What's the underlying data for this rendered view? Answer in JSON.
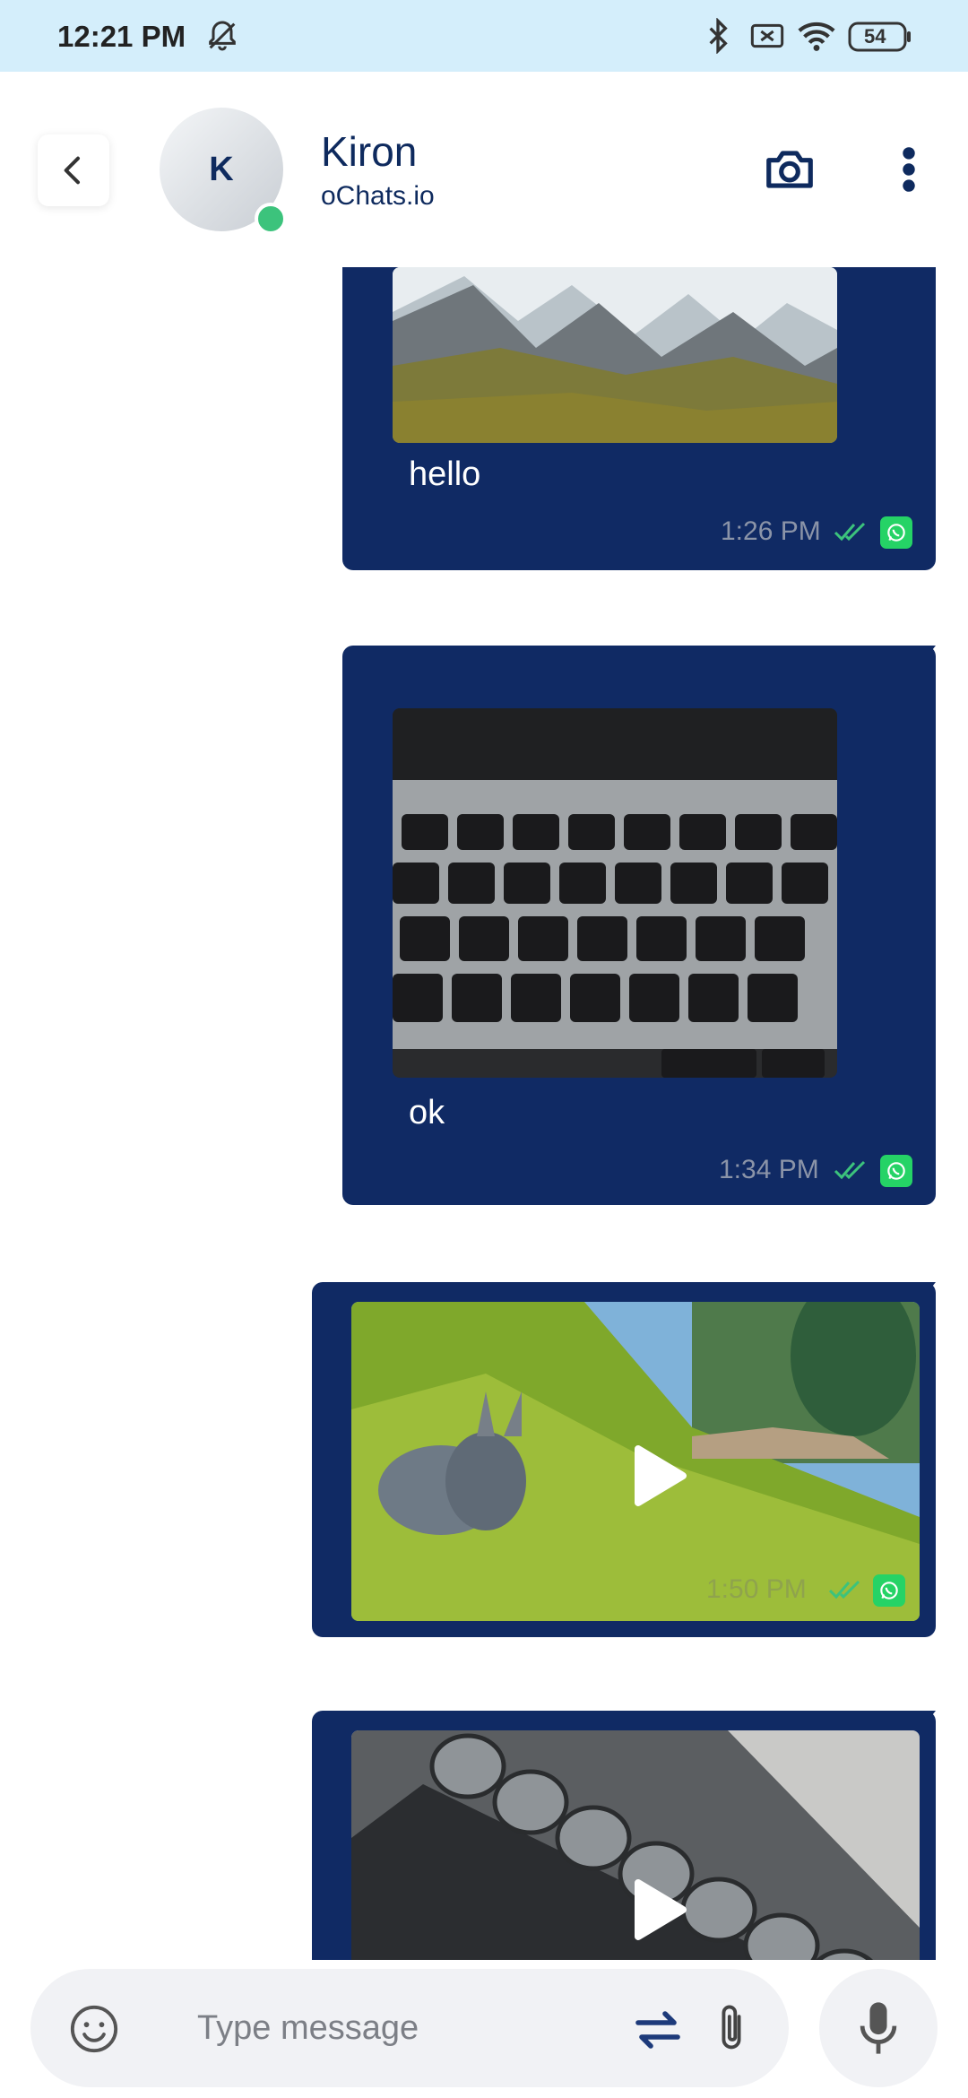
{
  "status_bar": {
    "time": "12:21 PM",
    "battery": "54",
    "icons": [
      "silent-bell-icon",
      "bluetooth-icon",
      "no-sim-icon",
      "wifi-icon",
      "battery-icon"
    ]
  },
  "header": {
    "avatar_initial": "K",
    "contact_name": "Kiron",
    "contact_subtitle": "oChats.io",
    "online": true
  },
  "messages": [
    {
      "type": "image",
      "caption": "hello",
      "time": "1:26 PM",
      "status": "read",
      "channel": "whatsapp"
    },
    {
      "type": "image",
      "caption": "ok",
      "time": "1:34 PM",
      "status": "read",
      "channel": "whatsapp"
    },
    {
      "type": "video",
      "time": "1:50 PM",
      "status": "read",
      "channel": "whatsapp"
    },
    {
      "type": "video"
    }
  ],
  "composer": {
    "placeholder": "Type message"
  },
  "colors": {
    "bubble": "#102a64",
    "status_bar": "#d4eefb",
    "accent_navy": "#0e2a5e",
    "online": "#3cc37c",
    "read_ticks": "#3cc37c",
    "whatsapp": "#25d366"
  }
}
